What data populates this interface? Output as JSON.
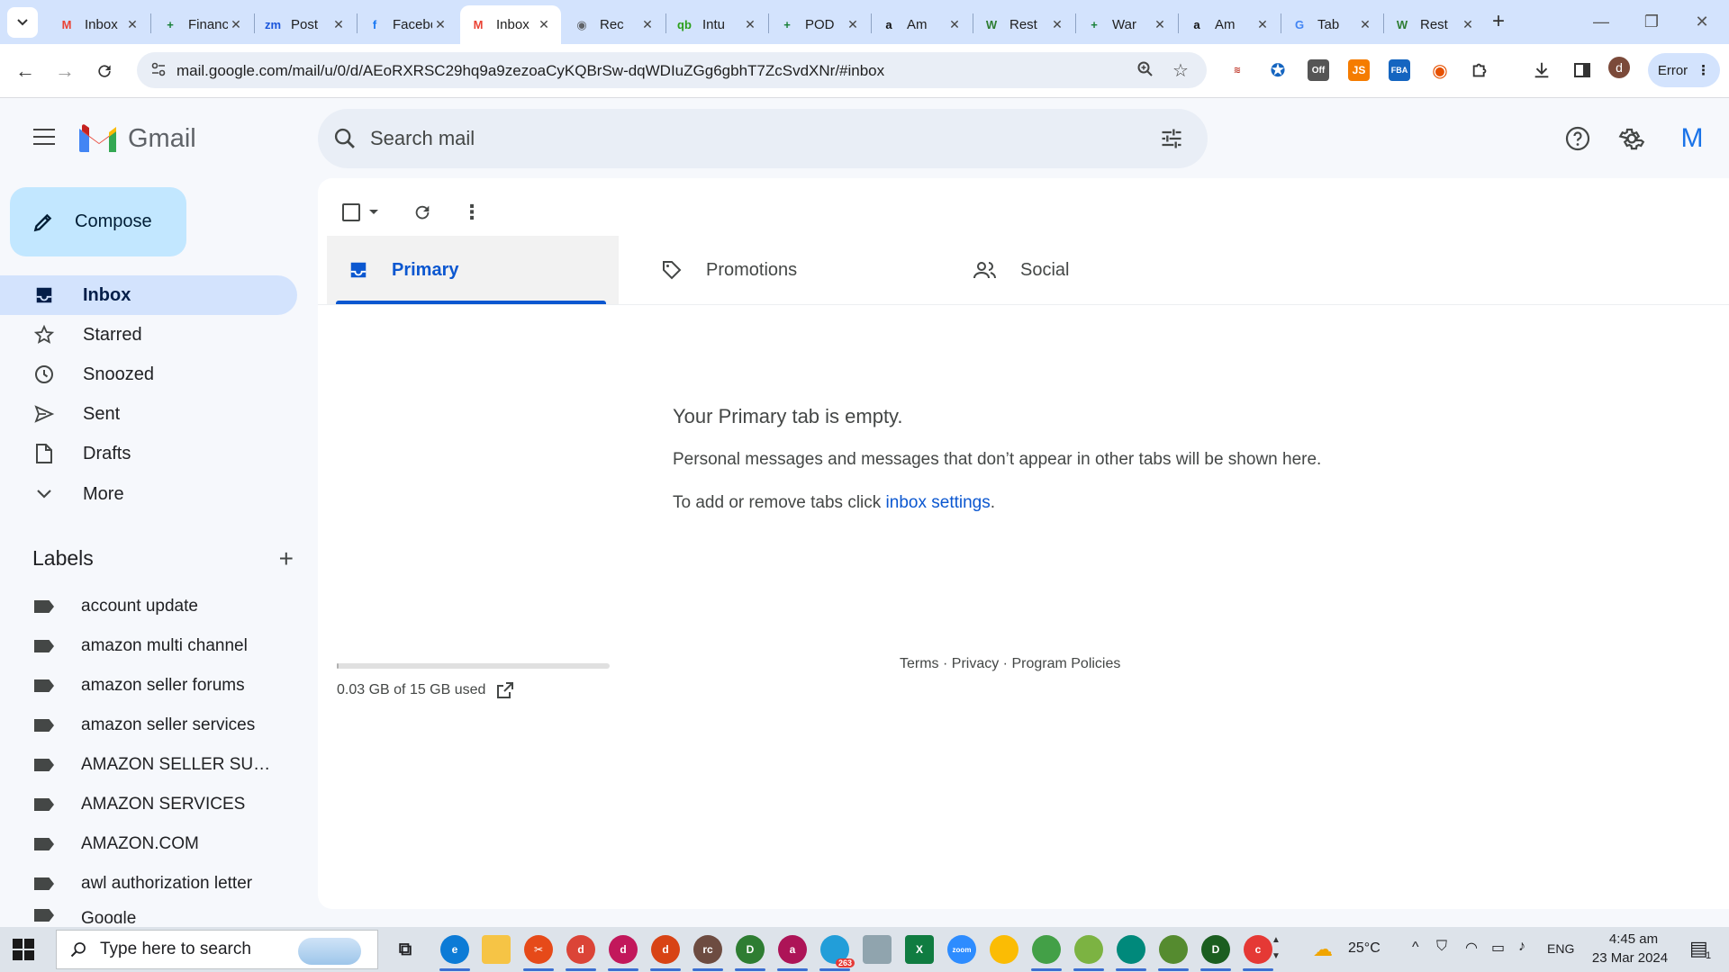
{
  "browser": {
    "tabs": [
      {
        "title": "Inbox",
        "favicon": "gmail-favicon",
        "color": "#ea4335",
        "glyph": "M",
        "active": false
      },
      {
        "title": "Finance",
        "favicon": "sheets-favicon",
        "color": "#188038",
        "glyph": "+",
        "active": false
      },
      {
        "title": "Post",
        "favicon": "zoho-favicon",
        "color": "#1a56db",
        "glyph": "zm",
        "active": false
      },
      {
        "title": "Facebook",
        "favicon": "facebook-favicon",
        "color": "#1877f2",
        "glyph": "f",
        "active": false
      },
      {
        "title": "Inbox",
        "favicon": "gmail-favicon",
        "color": "#ea4335",
        "glyph": "M",
        "active": true
      },
      {
        "title": "Rec",
        "favicon": "globe-favicon",
        "color": "#5f6368",
        "glyph": "◉",
        "active": false
      },
      {
        "title": "Intu",
        "favicon": "quickbooks-favicon",
        "color": "#2ca01c",
        "glyph": "qb",
        "active": false
      },
      {
        "title": "POD",
        "favicon": "sheets-favicon",
        "color": "#188038",
        "glyph": "+",
        "active": false
      },
      {
        "title": "Am",
        "favicon": "amazon-favicon",
        "color": "#111111",
        "glyph": "a",
        "active": false
      },
      {
        "title": "Rest",
        "favicon": "w-favicon",
        "color": "#2e7d32",
        "glyph": "W",
        "active": false
      },
      {
        "title": "War",
        "favicon": "sheets-favicon",
        "color": "#188038",
        "glyph": "+",
        "active": false
      },
      {
        "title": "Am",
        "favicon": "amazon-favicon",
        "color": "#111111",
        "glyph": "a",
        "active": false
      },
      {
        "title": "Tab",
        "favicon": "google-favicon",
        "color": "#4285f4",
        "glyph": "G",
        "active": false
      },
      {
        "title": "Rest",
        "favicon": "w-favicon",
        "color": "#2e7d32",
        "glyph": "W",
        "active": false
      }
    ],
    "url": "mail.google.com/mail/u/0/d/AEoRXRSC29hq9a9zezoaCyKQBrSw-dqWDIuZGg6gbhT7ZcSvdXNr/#inbox",
    "profile_initial": "d",
    "error_label": "Error"
  },
  "gmail": {
    "logo_text": "Gmail",
    "search_placeholder": "Search mail",
    "avatar_initial": "M",
    "compose_label": "Compose",
    "nav": [
      {
        "label": "Inbox",
        "icon": "inbox-icon",
        "active": true
      },
      {
        "label": "Starred",
        "icon": "star-icon",
        "active": false
      },
      {
        "label": "Snoozed",
        "icon": "clock-icon",
        "active": false
      },
      {
        "label": "Sent",
        "icon": "send-icon",
        "active": false
      },
      {
        "label": "Drafts",
        "icon": "draft-icon",
        "active": false
      },
      {
        "label": "More",
        "icon": "chevron-down-icon",
        "active": false
      }
    ],
    "labels_heading": "Labels",
    "labels": [
      "account update",
      "amazon multi channel",
      "amazon seller forums",
      "amazon seller services",
      "AMAZON SELLER SUPP...",
      "AMAZON SERVICES",
      "AMAZON.COM",
      "awl authorization letter",
      "Google"
    ],
    "category_tabs": [
      {
        "label": "Primary",
        "icon": "inbox-tab-icon",
        "active": true
      },
      {
        "label": "Promotions",
        "icon": "tag-icon",
        "active": false
      },
      {
        "label": "Social",
        "icon": "people-icon",
        "active": false
      }
    ],
    "empty_title": "Your Primary tab is empty.",
    "empty_desc": "Personal messages and messages that don’t appear in other tabs will be shown here.",
    "empty_settings_prefix": "To add or remove tabs click ",
    "empty_settings_link": "inbox settings",
    "empty_settings_suffix": ".",
    "storage_text": "0.03 GB of 15 GB used",
    "storage_fraction": 0.002,
    "footer": {
      "terms": "Terms",
      "sep": " · ",
      "privacy": "Privacy",
      "policies": "Program Policies"
    }
  },
  "taskbar": {
    "search_placeholder": "Type here to search",
    "telegram_badge": "263",
    "weather": "25°C",
    "language": "ENG",
    "time": "4:45 am",
    "date": "23 Mar 2024",
    "notification_count": "1"
  },
  "colors": {
    "accent": "#0b57d0",
    "compose_bg": "#c2e7ff",
    "nav_active_bg": "#d3e3fd",
    "tabstrip_bg": "#d3e3fd"
  }
}
